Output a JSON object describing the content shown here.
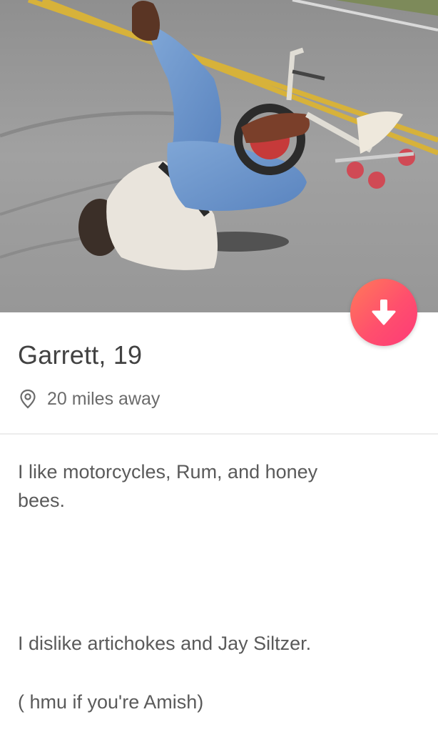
{
  "profile": {
    "name_age": "Garrett, 19",
    "distance": "20 miles away",
    "pin_icon": "location-pin-icon",
    "collapse_icon": "arrow-down-icon"
  },
  "bio": {
    "lines": [
      "I like motorcycles, Rum, and honey",
      "bees.",
      "I dislike artichokes and Jay Siltzer.",
      "( hmu if you're Amish)"
    ]
  },
  "colors": {
    "button_gradient_start": "#ff7a59",
    "button_gradient_end": "#fd3a78",
    "divider": "#ececec",
    "text": "#424242"
  }
}
